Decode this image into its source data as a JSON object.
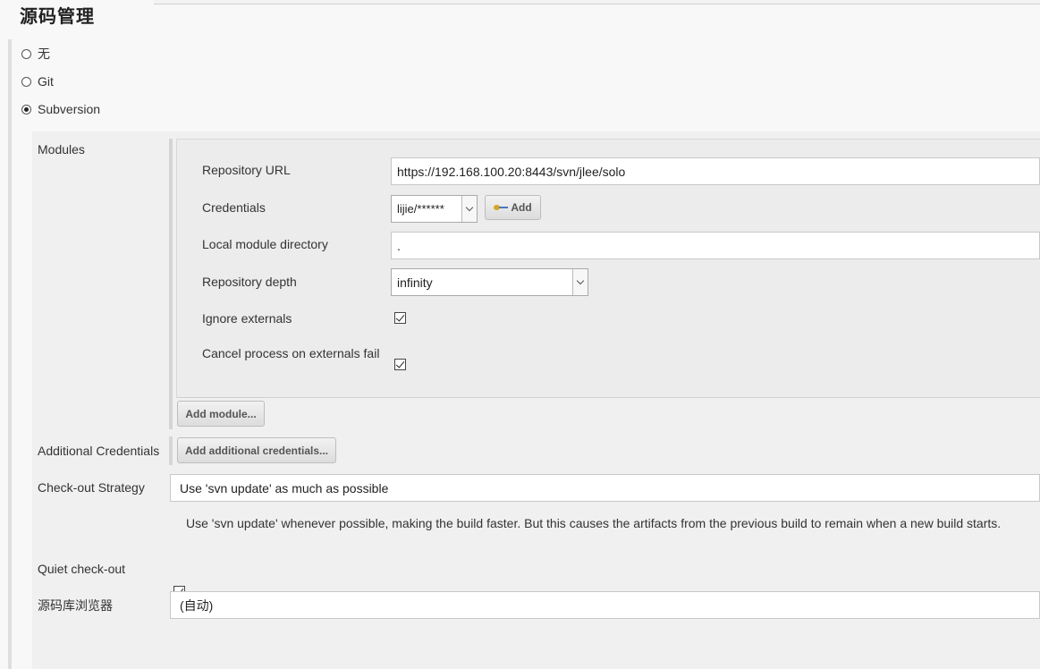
{
  "section": {
    "title": "源码管理"
  },
  "scm_options": [
    {
      "label": "无",
      "checked": false
    },
    {
      "label": "Git",
      "checked": false
    },
    {
      "label": "Subversion",
      "checked": true
    }
  ],
  "modules": {
    "label": "Modules",
    "repository_url_label": "Repository URL",
    "repository_url_value": "https://192.168.100.20:8443/svn/jlee/solo",
    "credentials_label": "Credentials",
    "credentials_value": "lijie/******",
    "add_button_label": "Add",
    "local_dir_label": "Local module directory",
    "local_dir_value": ".",
    "depth_label": "Repository depth",
    "depth_value": "infinity",
    "ignore_externals_label": "Ignore externals",
    "ignore_externals_checked": true,
    "cancel_externals_label": "Cancel process on externals fail",
    "cancel_externals_checked": true,
    "add_module_button": "Add module..."
  },
  "additional_credentials": {
    "label": "Additional Credentials",
    "button": "Add additional credentials..."
  },
  "checkout_strategy": {
    "label": "Check-out Strategy",
    "value": "Use 'svn update' as much as possible",
    "help": "Use 'svn update' whenever possible, making the build faster. But this causes the artifacts from the previous build to remain when a new build starts."
  },
  "quiet_checkout": {
    "label": "Quiet check-out",
    "checked": true
  },
  "repo_browser": {
    "label": "源码库浏览器",
    "value": "(自动)"
  },
  "icons": {
    "key": "key-icon",
    "dropdown": "chevron-down-icon"
  }
}
